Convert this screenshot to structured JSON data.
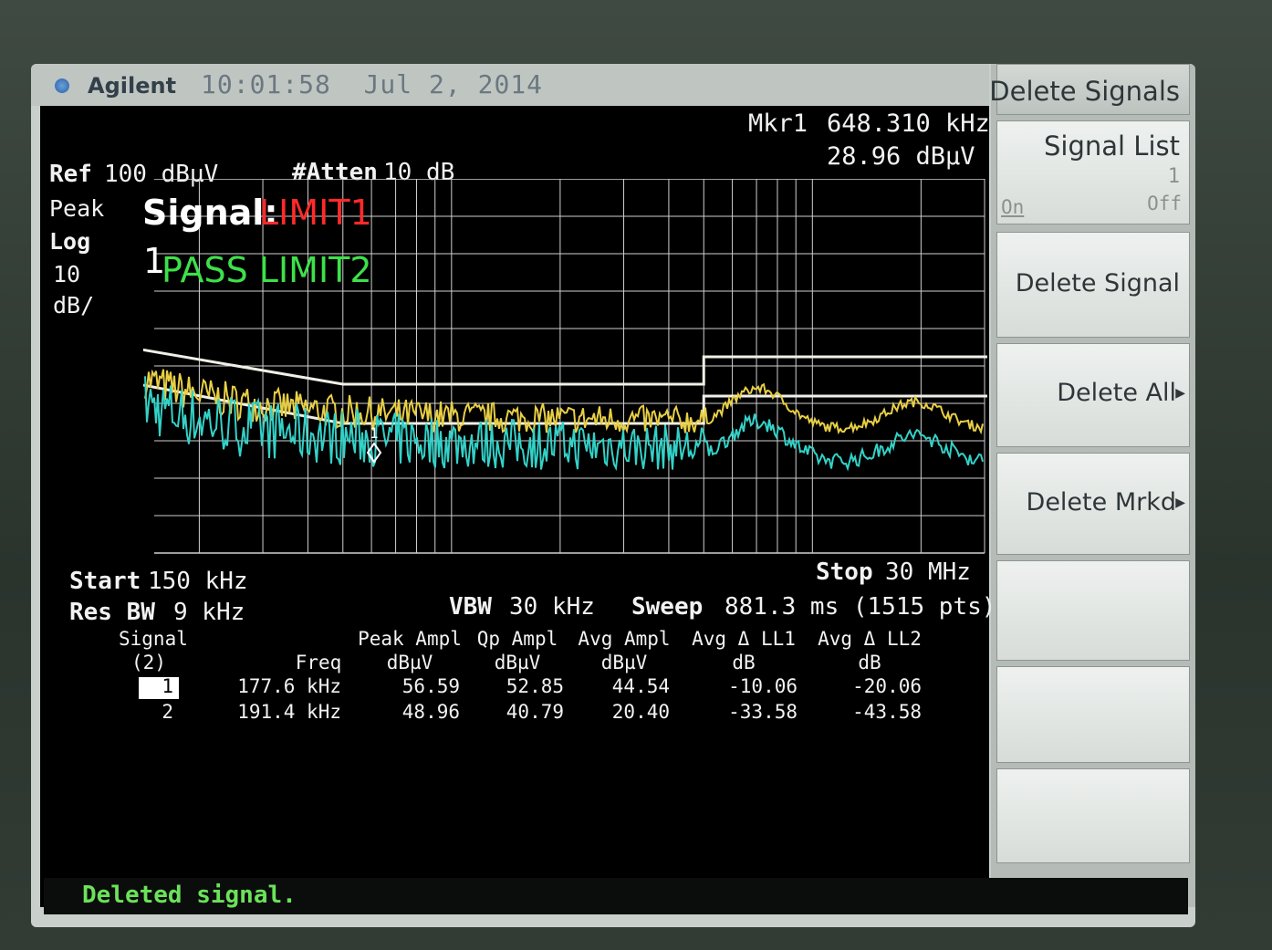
{
  "header": {
    "brand": "Agilent",
    "time": "10:01:58",
    "date": "Jul 2, 2014"
  },
  "marker": {
    "label": "Mkr1",
    "freq": "648.310 kHz",
    "ampl": "28.96 dBµV"
  },
  "settings": {
    "ref_label": "Ref",
    "ref_value": "100 dBµV",
    "atten_label": "#Atten",
    "atten_value": "10 dB",
    "detector": "Peak",
    "scale_type": "Log",
    "scale_div": "10",
    "scale_unit": "dB/",
    "start_label": "Start",
    "start_value": "150 kHz",
    "stop_label": "Stop",
    "stop_value": "30 MHz",
    "rbw_label": "Res BW",
    "rbw_value": "9 kHz",
    "vbw_label": "VBW",
    "vbw_value": "30 kHz",
    "sweep_label": "Sweep",
    "sweep_value": "881.3 ms (1515 pts)"
  },
  "overlay": {
    "signal_label": "Signal:",
    "limit1_label": "LIMIT1",
    "pass_prefix": "1",
    "limit2_label": "PASS LIMIT2"
  },
  "table": {
    "headers": {
      "signal": [
        "Signal",
        "(2)"
      ],
      "freq": [
        "",
        "Freq"
      ],
      "peak": [
        "Peak Ampl",
        "dBµV"
      ],
      "qp": [
        "Qp Ampl",
        "dBµV"
      ],
      "avg": [
        "Avg Ampl",
        "dBµV"
      ],
      "ll1": [
        "Avg Δ LL1",
        "dB"
      ],
      "ll2": [
        "Avg Δ LL2",
        "dB"
      ]
    },
    "rows": [
      {
        "signal": "1",
        "freq": "177.6 kHz",
        "peak": "56.59",
        "qp": "52.85",
        "avg": "44.54",
        "ll1": "-10.06",
        "ll2": "-20.06"
      },
      {
        "signal": "2",
        "freq": "191.4 kHz",
        "peak": "48.96",
        "qp": "40.79",
        "avg": "20.40",
        "ll1": "-33.58",
        "ll2": "-43.58"
      }
    ]
  },
  "softkeys": {
    "title": "Delete Signals",
    "signal_list": "Signal List",
    "signal_list_value": "1",
    "toggle_on": "On",
    "toggle_off": "Off",
    "delete_signal": "Delete Signal",
    "delete_all": "Delete All",
    "delete_mrkd": "Delete Mrkd"
  },
  "status": {
    "message": "Deleted signal."
  },
  "colors": {
    "trace_peak": "#e8cf45",
    "trace_avg": "#33d2c8",
    "limit_line": "#f0f0e8",
    "grid": "#cfcfcf",
    "limit1_text": "#ff2a2a",
    "limit2_text": "#3ee04a",
    "status_text": "#6be25a"
  },
  "marker_symbol": "1"
}
